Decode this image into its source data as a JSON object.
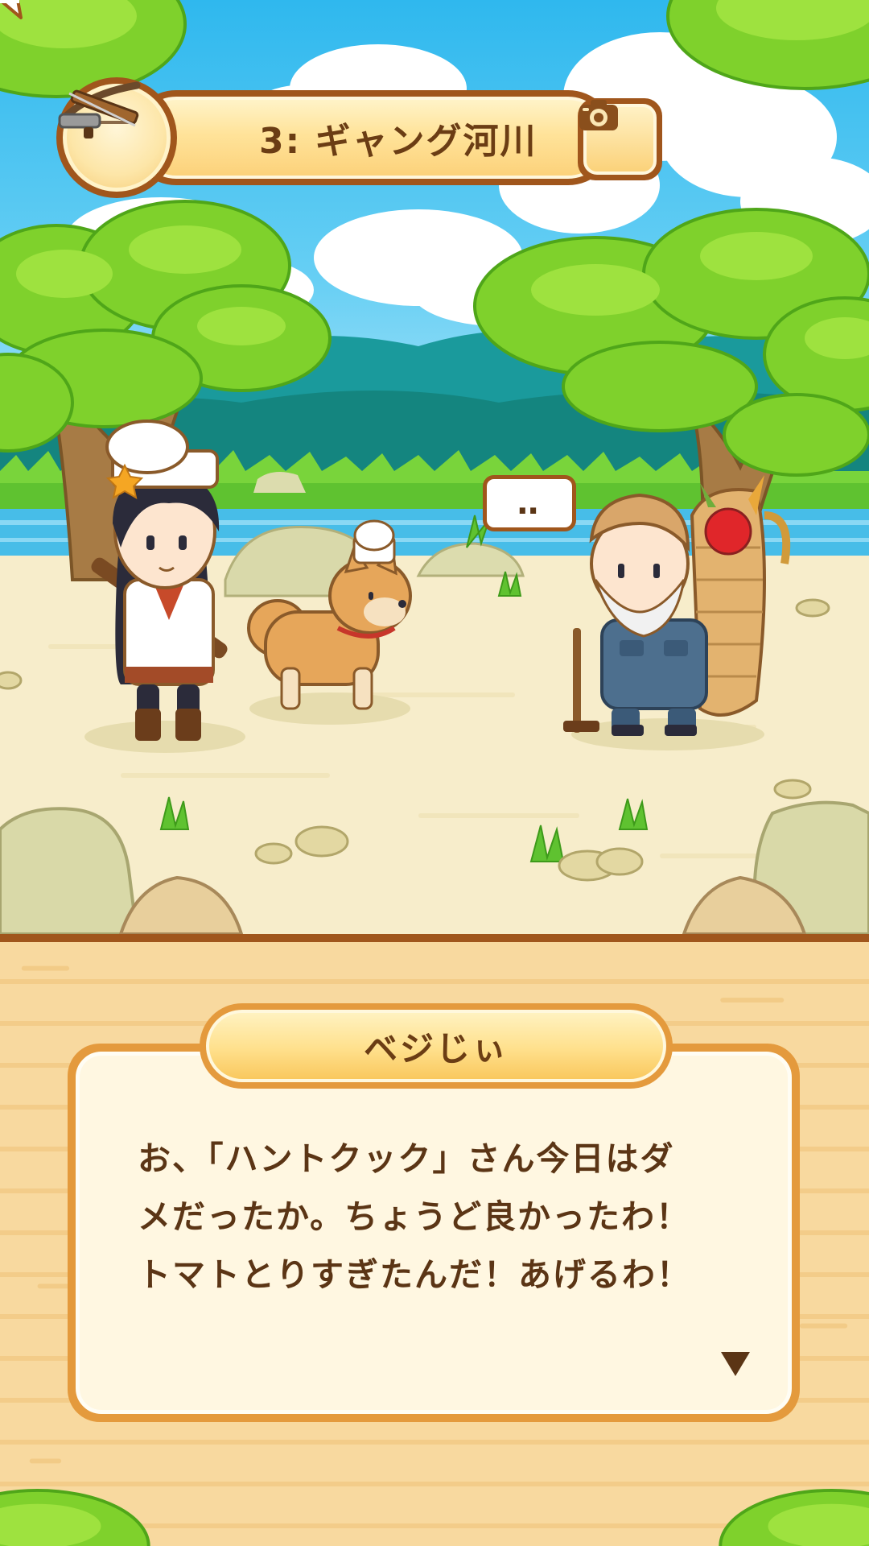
{
  "stage": {
    "label": "3: ギャング河川",
    "icon": "crossbow-icon"
  },
  "camera": {
    "icon": "camera-icon"
  },
  "scene": {
    "speech_bubble": "‥"
  },
  "dialog": {
    "speaker": "ベジじぃ",
    "lines": [
      "お、「ハントクック」さん今日はダ",
      "メだったか。ちょうど良かったわ！",
      "トマトとりすぎたんだ！あげるわ！"
    ],
    "next_icon": "triangle-down-icon"
  },
  "colors": {
    "frame_brown": "#a0561c",
    "text_brown": "#5b3515",
    "panel_orange": "#e49a3d",
    "sky_blue": "#2fb8ee"
  }
}
